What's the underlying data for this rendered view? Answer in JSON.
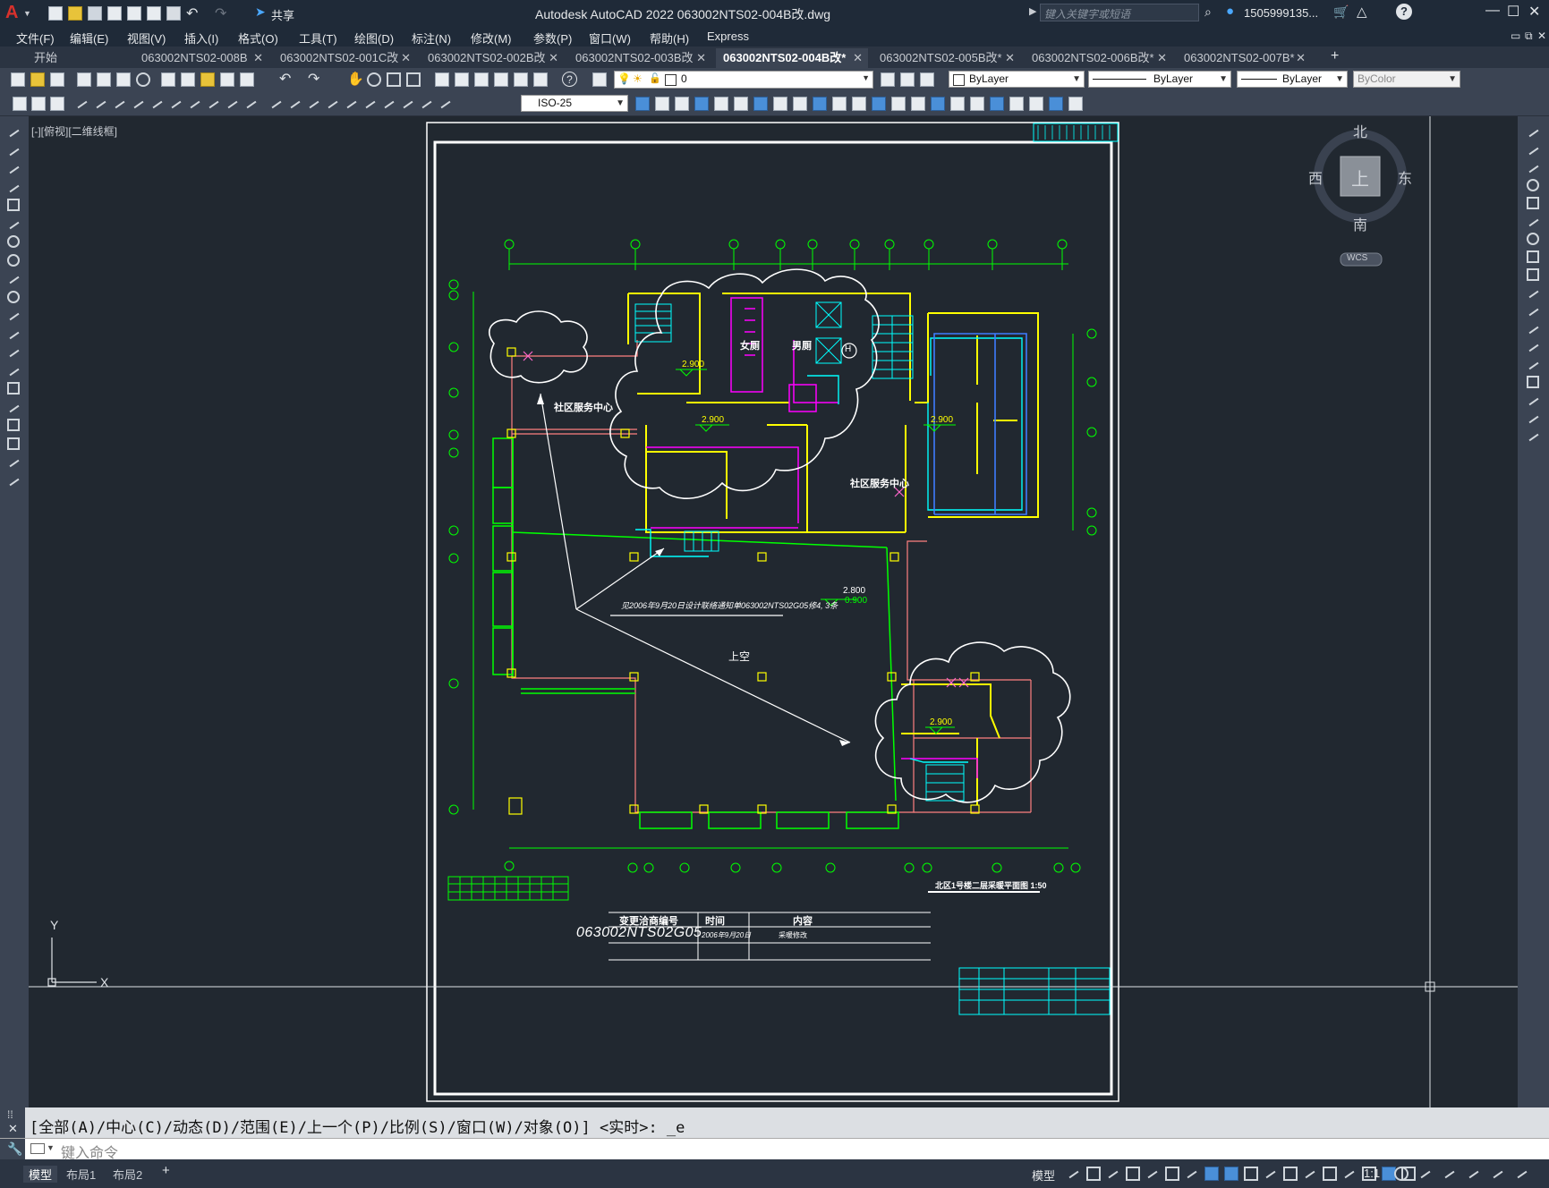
{
  "app": {
    "logo": "A",
    "title": "Autodesk AutoCAD 2022    063002NTS02-004B改.dwg",
    "share_label": "共享",
    "search_placeholder": "键入关键字或短语",
    "user": "1505999135...",
    "help": "?"
  },
  "menu": [
    "文件(F)",
    "编辑(E)",
    "视图(V)",
    "插入(I)",
    "格式(O)",
    "工具(T)",
    "绘图(D)",
    "标注(N)",
    "修改(M)",
    "参数(P)",
    "窗口(W)",
    "帮助(H)",
    "Express"
  ],
  "tabs": [
    {
      "label": "开始",
      "active": false
    },
    {
      "label": "063002NTS02-008B",
      "active": false
    },
    {
      "label": "063002NTS02-001C改",
      "active": false
    },
    {
      "label": "063002NTS02-002B改",
      "active": false
    },
    {
      "label": "063002NTS02-003B改",
      "active": false
    },
    {
      "label": "063002NTS02-004B改*",
      "active": true
    },
    {
      "label": "063002NTS02-005B改*",
      "active": false
    },
    {
      "label": "063002NTS02-006B改*",
      "active": false
    },
    {
      "label": "063002NTS02-007B*",
      "active": false
    }
  ],
  "toolbar": {
    "layer_value": "0",
    "color_value": "ByLayer",
    "linetype_value": "ByLayer",
    "lineweight_value": "ByLayer",
    "plotstyle_value": "ByColor",
    "dimstyle_value": "ISO-25"
  },
  "viewport": {
    "label": "[-][俯视][二维线框]",
    "viewcube": {
      "north": "北",
      "south": "南",
      "east": "东",
      "west": "西",
      "top": "上",
      "wcs": "WCS"
    },
    "ucs": {
      "x": "X",
      "y": "Y"
    }
  },
  "drawing": {
    "room_labels": {
      "community_a": "社区服务中心",
      "community_b": "社区服务中心",
      "female_wc": "女厕",
      "male_wc": "男厕",
      "void": "上空",
      "elev_mark": "H"
    },
    "elevations": [
      "2.900",
      "2.900",
      "2.900",
      "2.800",
      "0.900",
      "2.900"
    ],
    "change_note": "见2006年9月20日设计联络通知单063002NTS02G05修4, 3条",
    "plan_title": "北区1号楼二层采暖平面图 1:50",
    "change_table": {
      "headers": [
        "变更洽商编号",
        "时间",
        "内容"
      ],
      "row": {
        "number": "063002NTS02G05",
        "date": "2006年9月20日",
        "content": "采暖修改"
      }
    }
  },
  "command": {
    "history": "[全部(A)/中心(C)/动态(D)/范围(E)/上一个(P)/比例(S)/窗口(W)/对象(O)] <实时>: _e",
    "input_placeholder": "键入命令"
  },
  "status": {
    "layout_tabs": [
      "模型",
      "布局1",
      "布局2"
    ],
    "model_label": "模型",
    "scale": "1:1"
  },
  "colors": {
    "cad_background": "#212830",
    "green": "#00ff00",
    "yellow": "#ffff00",
    "magenta": "#ff00ff",
    "cyan": "#00ffff",
    "blue": "#3f7cff",
    "red": "#ff8080"
  }
}
